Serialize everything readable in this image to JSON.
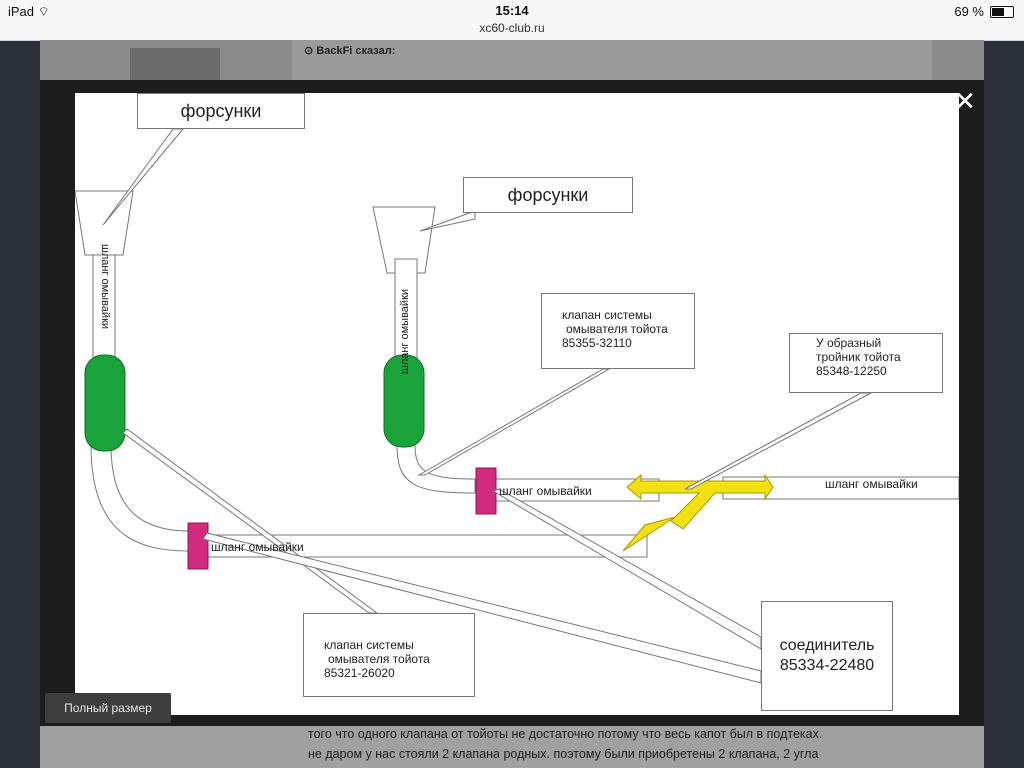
{
  "statusbar": {
    "device": "iPad",
    "time": "15:14",
    "url": "xc60-club.ru",
    "battery": "69 %",
    "battery_level": 0.69
  },
  "forum": {
    "quote_author": "BackFi сказал:",
    "full_size_button": "Полный размер",
    "body_lines": [
      "того что одного клапана от тойоты не достаточно потому что весь капот был в подтеках.",
      "не даром у нас стояли 2 клапана родных. поэтому были приобретены 2 клапана, 2 угла"
    ]
  },
  "diagram": {
    "injectors_label_1": "форсунки",
    "injectors_label_2": "форсунки",
    "hose_vertical_1": "шланг омывайки",
    "hose_vertical_2": "шланг омывайки",
    "hose_horizontal_1": "шланг омывайки",
    "hose_horizontal_2": "шланг омывайки",
    "hose_horizontal_3": "шланг омывайки",
    "valve_top": [
      "клапан системы",
      "омывателя тойота",
      "85355-32110"
    ],
    "valve_bottom": [
      "клапан системы",
      "омывателя тойота",
      "85321-26020"
    ],
    "tee": [
      "У образный",
      "тройник тойота",
      "85348-12250"
    ],
    "connector": [
      "соединитель",
      "85334-22480"
    ],
    "colors": {
      "valve": "#1aa33a",
      "connector": "#d12a7f",
      "tee": "#f2e010"
    }
  }
}
